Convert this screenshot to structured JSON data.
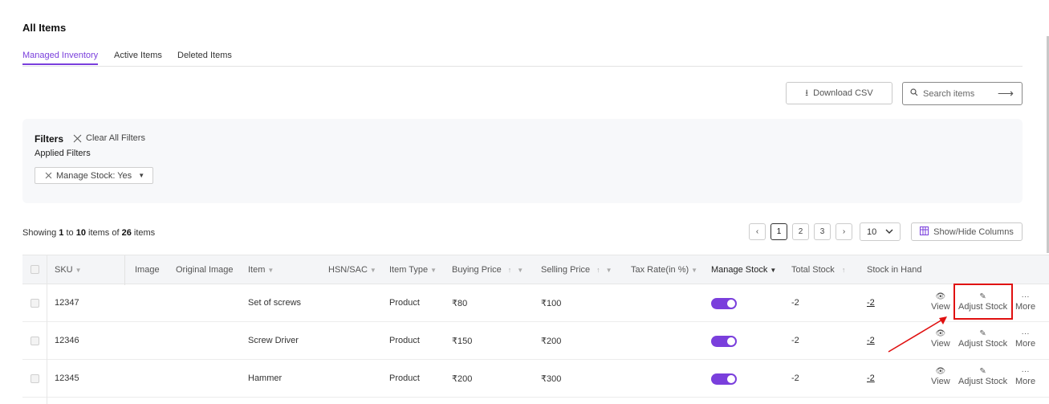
{
  "page": {
    "title": "All Items"
  },
  "tabs": [
    {
      "label": "Managed Inventory",
      "active": true
    },
    {
      "label": "Active Items",
      "active": false
    },
    {
      "label": "Deleted Items",
      "active": false
    }
  ],
  "toolbar": {
    "download_label": "Download CSV",
    "search_placeholder": "Search items"
  },
  "filters": {
    "title": "Filters",
    "clear_label": "Clear All Filters",
    "applied_label": "Applied Filters",
    "chips": [
      {
        "label": "Manage Stock: Yes"
      }
    ]
  },
  "pagination": {
    "from": "1",
    "to": "10",
    "total": "26",
    "pages": [
      "1",
      "2",
      "3"
    ],
    "current_page": "1",
    "per_page": "10",
    "text_showing": "Showing",
    "text_to": "to",
    "text_items_of": "items of",
    "text_items": "items"
  },
  "columns_button_label": "Show/Hide Columns",
  "table": {
    "headers": {
      "sku": "SKU",
      "image": "Image",
      "original_image": "Original Image",
      "item": "Item",
      "hsn": "HSN/SAC",
      "item_type": "Item Type",
      "buying_price": "Buying Price",
      "selling_price": "Selling Price",
      "tax_rate": "Tax Rate(in %)",
      "manage_stock": "Manage Stock",
      "total_stock": "Total Stock",
      "stock_in_hand": "Stock in Hand"
    },
    "rows": [
      {
        "sku": "12347",
        "item": "Set of screws",
        "item_type": "Product",
        "buying_price": "₹80",
        "selling_price": "₹100",
        "manage_stock": true,
        "total_stock": "-2",
        "stock_in_hand": "-2"
      },
      {
        "sku": "12346",
        "item": "Screw Driver",
        "item_type": "Product",
        "buying_price": "₹150",
        "selling_price": "₹200",
        "manage_stock": true,
        "total_stock": "-2",
        "stock_in_hand": "-2"
      },
      {
        "sku": "12345",
        "item": "Hammer",
        "item_type": "Product",
        "buying_price": "₹200",
        "selling_price": "₹300",
        "manage_stock": true,
        "total_stock": "-2",
        "stock_in_hand": "-2"
      }
    ],
    "actions": {
      "view": "View",
      "adjust_stock": "Adjust Stock",
      "more": "More"
    }
  },
  "colors": {
    "accent": "#7a3fdc",
    "annotation": "#e01010"
  },
  "icons": [
    "download-icon",
    "search-icon",
    "arrow-right-icon",
    "close-icon",
    "caret-down-icon",
    "chevron-left-icon",
    "chevron-right-icon",
    "chevron-down-icon",
    "columns-icon",
    "eye-icon",
    "pencil-icon",
    "more-icon",
    "sort-up-icon",
    "filter-icon"
  ]
}
